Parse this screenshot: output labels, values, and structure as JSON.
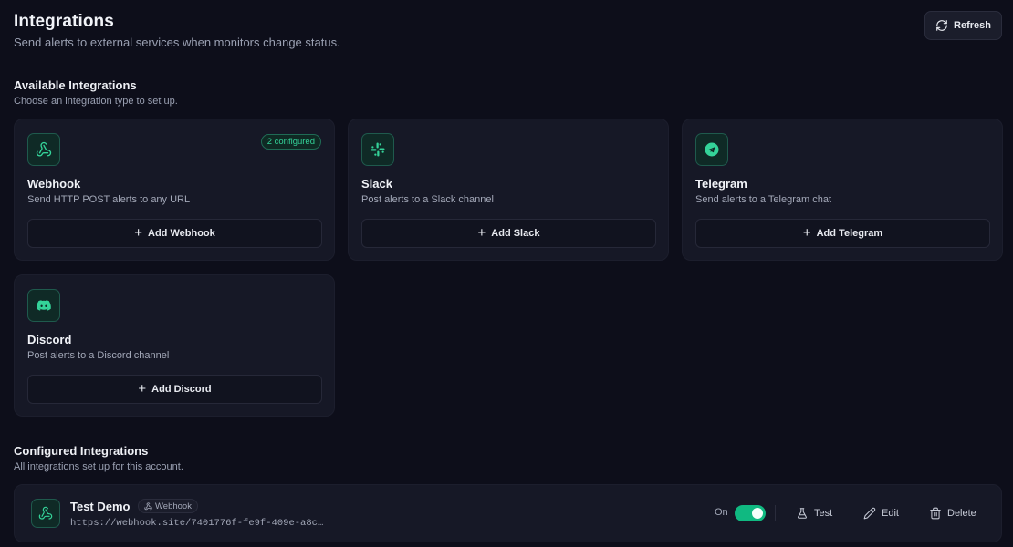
{
  "header": {
    "title": "Integrations",
    "subtitle": "Send alerts to external services when monitors change status.",
    "refresh_label": "Refresh"
  },
  "available": {
    "title": "Available Integrations",
    "subtitle": "Choose an integration type to set up.",
    "cards": [
      {
        "name": "Webhook",
        "description": "Send HTTP POST alerts to any URL",
        "button": "Add Webhook",
        "badge": "2 configured",
        "icon": "webhook-icon"
      },
      {
        "name": "Slack",
        "description": "Post alerts to a Slack channel",
        "button": "Add Slack",
        "icon": "slack-icon"
      },
      {
        "name": "Telegram",
        "description": "Send alerts to a Telegram chat",
        "button": "Add Telegram",
        "icon": "telegram-icon"
      },
      {
        "name": "Discord",
        "description": "Post alerts to a Discord channel",
        "button": "Add Discord",
        "icon": "discord-icon"
      }
    ]
  },
  "configured": {
    "title": "Configured Integrations",
    "subtitle": "All integrations set up for this account.",
    "items": [
      {
        "name": "Test Demo",
        "type": "Webhook",
        "url": "https://webhook.site/7401776f-fe9f-409e-a8c…",
        "toggle_label": "On",
        "enabled": true,
        "actions": {
          "test": "Test",
          "edit": "Edit",
          "delete": "Delete"
        }
      }
    ]
  },
  "colors": {
    "background": "#0d0e1a",
    "card": "#161826",
    "accent": "#34d399",
    "toggle_on": "#10b981"
  }
}
